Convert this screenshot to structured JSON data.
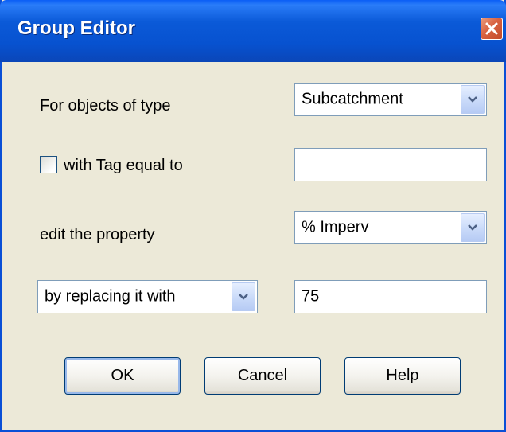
{
  "window": {
    "title": "Group Editor",
    "close_icon": "close-icon"
  },
  "form": {
    "object_type_label": "For objects of type",
    "object_type_value": "Subcatchment",
    "tag_filter_label": "with Tag equal to",
    "tag_filter_checked": false,
    "tag_value": "",
    "property_label": "edit the property",
    "property_value": "% Imperv",
    "action_value": "by replacing it with",
    "new_value": "75"
  },
  "buttons": {
    "ok_label": "OK",
    "cancel_label": "Cancel",
    "help_label": "Help"
  },
  "colors": {
    "titlebar": "#0752d0",
    "dialog_background": "#ece9d8",
    "close_button": "#d86140"
  }
}
